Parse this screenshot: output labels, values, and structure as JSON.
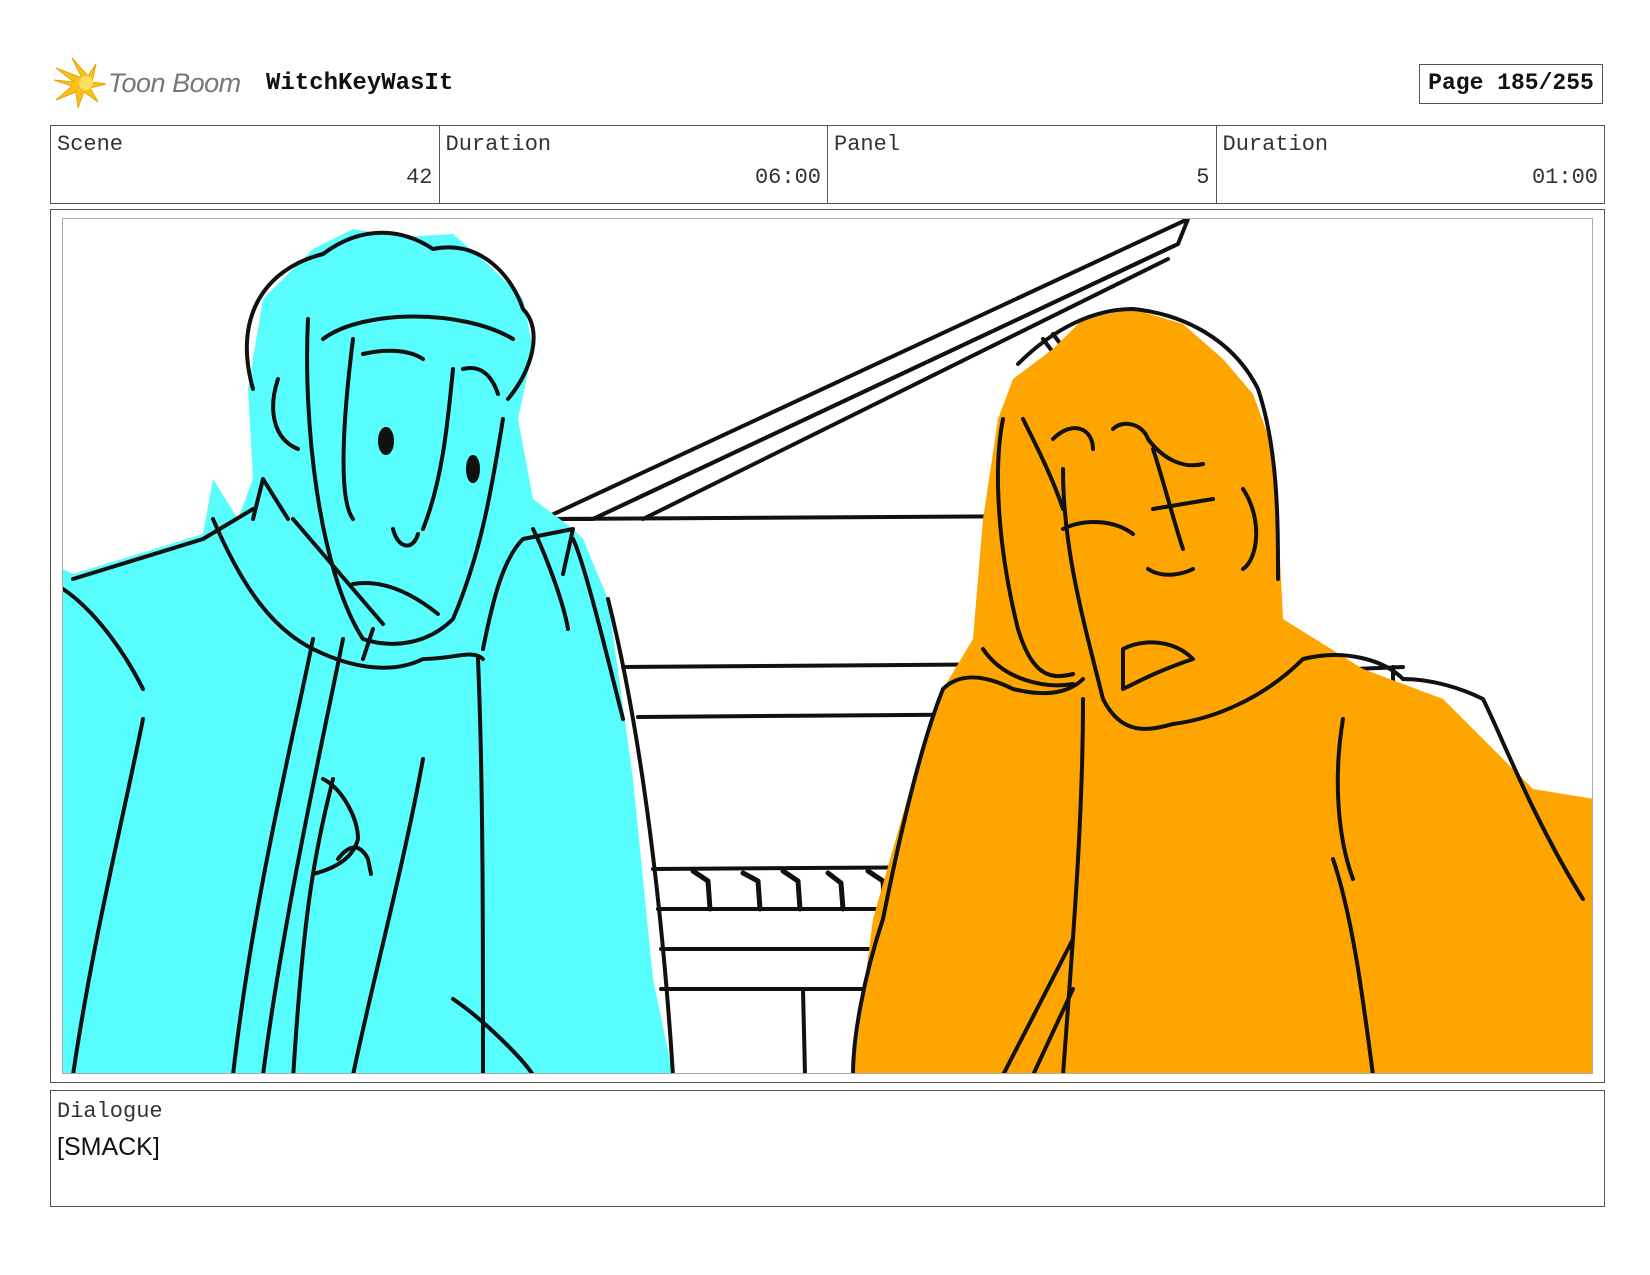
{
  "header": {
    "logo_text": "Toon Boom",
    "project_title": "WitchKeyWasIt",
    "page_label": "Page 185/255"
  },
  "info": {
    "scene_label": "Scene",
    "scene_value": "42",
    "scene_duration_label": "Duration",
    "scene_duration_value": "06:00",
    "panel_label": "Panel",
    "panel_value": "5",
    "panel_duration_label": "Duration",
    "panel_duration_value": "01:00"
  },
  "dialogue": {
    "label": "Dialogue",
    "text": "[SMACK]"
  },
  "colors": {
    "left_character_fill": "#58fdfd",
    "right_character_fill": "#ffa500",
    "logo_star": "#f7c21b",
    "line": "#111111"
  }
}
